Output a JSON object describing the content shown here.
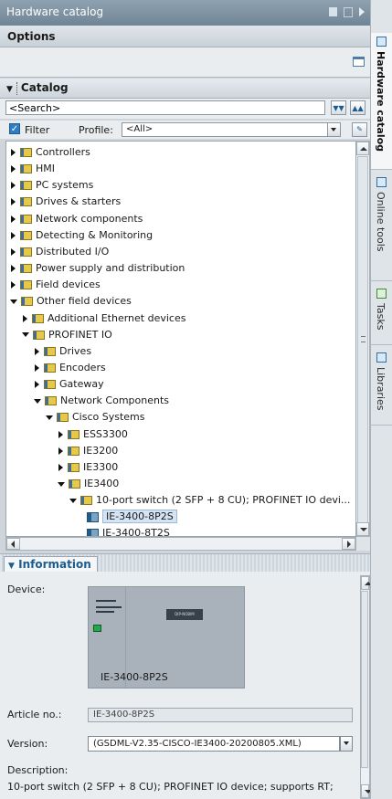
{
  "title": "Hardware catalog",
  "options": {
    "label": "Options"
  },
  "catalog": {
    "label": "Catalog",
    "search_placeholder": "<Search>",
    "filter_label": "Filter",
    "profile_label": "Profile:",
    "profile_value": "<All>"
  },
  "tree": [
    {
      "label": "Controllers",
      "level": 0,
      "state": "collapsed",
      "kind": "folder"
    },
    {
      "label": "HMI",
      "level": 0,
      "state": "collapsed",
      "kind": "folder"
    },
    {
      "label": "PC systems",
      "level": 0,
      "state": "collapsed",
      "kind": "folder"
    },
    {
      "label": "Drives & starters",
      "level": 0,
      "state": "collapsed",
      "kind": "folder"
    },
    {
      "label": "Network components",
      "level": 0,
      "state": "collapsed",
      "kind": "folder"
    },
    {
      "label": "Detecting & Monitoring",
      "level": 0,
      "state": "collapsed",
      "kind": "folder"
    },
    {
      "label": "Distributed I/O",
      "level": 0,
      "state": "collapsed",
      "kind": "folder"
    },
    {
      "label": "Power supply and distribution",
      "level": 0,
      "state": "collapsed",
      "kind": "folder"
    },
    {
      "label": "Field devices",
      "level": 0,
      "state": "collapsed",
      "kind": "folder"
    },
    {
      "label": "Other field devices",
      "level": 0,
      "state": "expanded",
      "kind": "folder"
    },
    {
      "label": "Additional Ethernet devices",
      "level": 1,
      "state": "collapsed",
      "kind": "folder"
    },
    {
      "label": "PROFINET IO",
      "level": 1,
      "state": "expanded",
      "kind": "folder"
    },
    {
      "label": "Drives",
      "level": 2,
      "state": "collapsed",
      "kind": "folder"
    },
    {
      "label": "Encoders",
      "level": 2,
      "state": "collapsed",
      "kind": "folder"
    },
    {
      "label": "Gateway",
      "level": 2,
      "state": "collapsed",
      "kind": "folder"
    },
    {
      "label": "Network Components",
      "level": 2,
      "state": "expanded",
      "kind": "folder"
    },
    {
      "label": "Cisco Systems",
      "level": 3,
      "state": "expanded",
      "kind": "folder"
    },
    {
      "label": "ESS3300",
      "level": 4,
      "state": "collapsed",
      "kind": "folder"
    },
    {
      "label": "IE3200",
      "level": 4,
      "state": "collapsed",
      "kind": "folder"
    },
    {
      "label": "IE3300",
      "level": 4,
      "state": "collapsed",
      "kind": "folder"
    },
    {
      "label": "IE3400",
      "level": 4,
      "state": "expanded",
      "kind": "folder"
    },
    {
      "label": "10-port switch (2 SFP + 8 CU); PROFINET IO devi...",
      "level": 5,
      "state": "expanded",
      "kind": "folder"
    },
    {
      "label": "IE-3400-8P2S",
      "level": 6,
      "state": "leaf",
      "kind": "device",
      "selected": true
    },
    {
      "label": "IE-3400-8T2S",
      "level": 6,
      "state": "leaf",
      "kind": "device"
    }
  ],
  "information": {
    "tab_label": "Information",
    "device_label": "Device:",
    "device_name": "IE-3400-8P2S",
    "device_plate_text": "DIP-NOBIM",
    "article_label": "Article no.:",
    "article_value": "IE-3400-8P2S",
    "version_label": "Version:",
    "version_value": "(GSDML-V2.35-CISCO-IE3400-20200805.XML)",
    "description_label": "Description:",
    "description_value": "10-port switch (2 SFP + 8 CU); PROFINET IO device; supports RT;"
  },
  "side_tabs": [
    {
      "label": "Hardware catalog",
      "active": true
    },
    {
      "label": "Online tools",
      "active": false
    },
    {
      "label": "Tasks",
      "active": false
    },
    {
      "label": "Libraries",
      "active": false
    }
  ],
  "colors": {
    "accent": "#1d5c8f",
    "titlebar": "#7b8fa0",
    "selection": "#d5e4f4",
    "folder": "#e7c94a"
  }
}
